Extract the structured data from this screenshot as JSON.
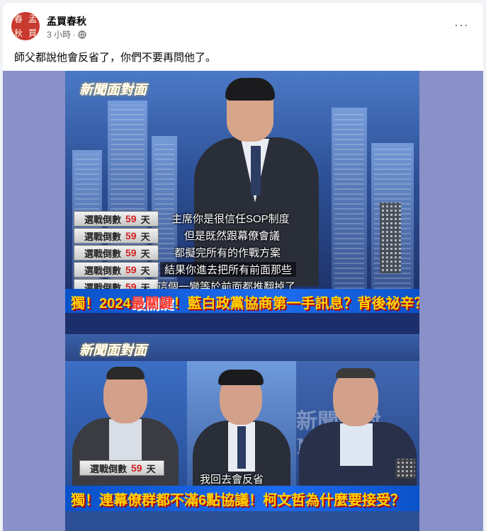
{
  "post": {
    "author": "孟買春秋",
    "avatar_chars": [
      "春",
      "孟",
      "秋",
      "買"
    ],
    "time": "3 小時",
    "separator": "·",
    "more": "···",
    "text": "師父都說他會反省了，你們不要再問他了。"
  },
  "image": {
    "frame1": {
      "logo": "新聞面對面",
      "countdown_label": "選戰倒數",
      "countdown_num": "59",
      "countdown_unit": "天",
      "subtitles": [
        "主席你是很信任SOP制度",
        "但是既然跟幕僚會議",
        "都擬完所有的作戰方案",
        "結果你進去把所有前面那些",
        "這個一變等於前面都推翻掉了"
      ],
      "banner_a": "獨！2024",
      "banner_b": "最關鍵",
      "banner_c": "！藍白政黨協商第一手訊息？背後祕辛？"
    },
    "frame2": {
      "logo": "新聞面對面",
      "watermark": "新聞面對 NEWS",
      "countdown_label": "選戰倒數",
      "countdown_num": "59",
      "countdown_unit": "天",
      "subtitle": "我回去會反省",
      "banner_a": "獨！連幕僚群都不滿6點協議！",
      "banner_b": "柯文哲為什麼要接受？"
    }
  },
  "colors": {
    "avatar": "#c8392f",
    "background": "#8a90c8",
    "banner_blue": "#1d6cf0",
    "banner_yellow": "#ffd400"
  }
}
